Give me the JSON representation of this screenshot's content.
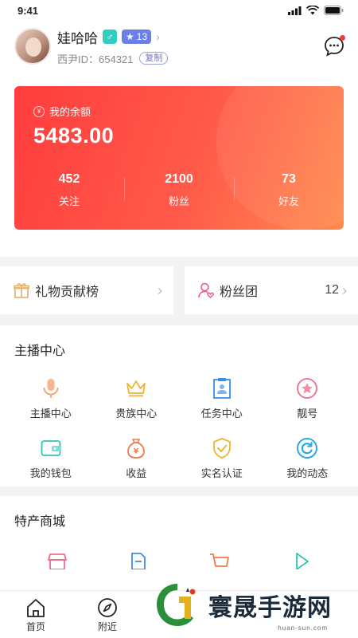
{
  "status": {
    "time": "9:41"
  },
  "profile": {
    "name": "娃哈哈",
    "gender_symbol": "♂",
    "level": "13",
    "id_text": "西尹ID：654321",
    "copy_label": "复制"
  },
  "wallet": {
    "balance_label": "我的余额",
    "balance": "5483.00",
    "stats": [
      {
        "num": "452",
        "label": "关注"
      },
      {
        "num": "2100",
        "label": "粉丝"
      },
      {
        "num": "73",
        "label": "好友"
      }
    ]
  },
  "quick": {
    "gift_rank": "礼物贡献榜",
    "fan_group": "粉丝团",
    "fan_group_count": "12"
  },
  "anchor_center": {
    "title": "主播中心",
    "items": [
      {
        "label": "主播中心",
        "icon": "microphone-icon",
        "color": "#f2a170"
      },
      {
        "label": "贵族中心",
        "icon": "crown-icon",
        "color": "#f0b530"
      },
      {
        "label": "任务中心",
        "icon": "task-icon",
        "color": "#3b8fe8"
      },
      {
        "label": "靓号",
        "icon": "star-badge-icon",
        "color": "#ef6d86"
      },
      {
        "label": "我的钱包",
        "icon": "wallet-icon",
        "color": "#2ec4b8"
      },
      {
        "label": "收益",
        "icon": "money-bag-icon",
        "color": "#f07a4a"
      },
      {
        "label": "实名认证",
        "icon": "shield-check-icon",
        "color": "#f0b530"
      },
      {
        "label": "我的动态",
        "icon": "refresh-circle-icon",
        "color": "#2ba8e8"
      }
    ]
  },
  "shop": {
    "title": "特产商城"
  },
  "tabs": [
    {
      "label": "首页",
      "icon": "home-icon"
    },
    {
      "label": "附近",
      "icon": "compass-icon"
    }
  ],
  "watermark": {
    "title": "寰晟手游网",
    "sub": "huan-sun.com"
  }
}
